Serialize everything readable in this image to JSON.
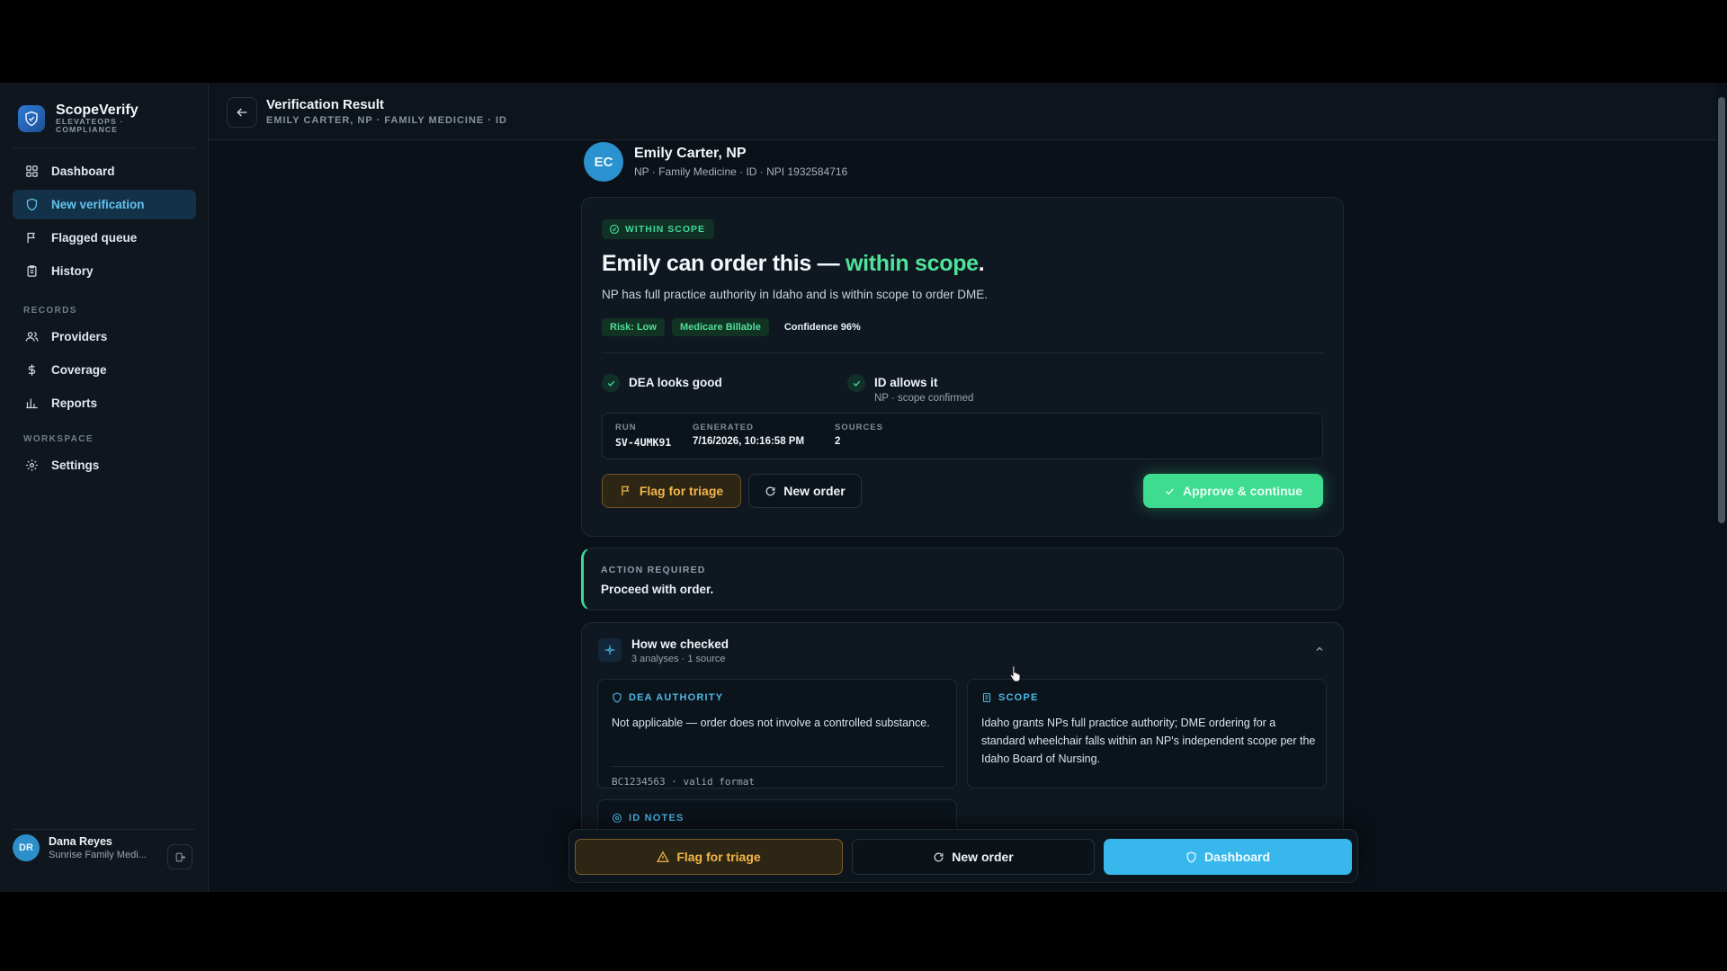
{
  "brand": {
    "name": "ScopeVerify",
    "subtitle": "ELEVATEOPS · COMPLIANCE"
  },
  "nav": {
    "main": [
      {
        "label": "Dashboard",
        "icon": "grid-icon",
        "active": false
      },
      {
        "label": "New verification",
        "icon": "shield-icon",
        "active": true
      },
      {
        "label": "Flagged queue",
        "icon": "flag-icon",
        "active": false
      },
      {
        "label": "History",
        "icon": "clipboard-icon",
        "active": false
      }
    ],
    "records_label": "RECORDS",
    "records": [
      {
        "label": "Providers",
        "icon": "users-icon"
      },
      {
        "label": "Coverage",
        "icon": "dollar-icon"
      },
      {
        "label": "Reports",
        "icon": "bar-chart-icon"
      }
    ],
    "workspace_label": "WORKSPACE",
    "workspace": [
      {
        "label": "Settings",
        "icon": "gear-icon"
      }
    ]
  },
  "user": {
    "initials": "DR",
    "name": "Dana Reyes",
    "org": "Sunrise Family Medi..."
  },
  "header": {
    "title": "Verification Result",
    "subtitle": "EMILY CARTER, NP · FAMILY MEDICINE · ID"
  },
  "provider": {
    "initials": "EC",
    "name": "Emily Carter, NP",
    "meta": "NP · Family Medicine · ID · NPI 1932584716"
  },
  "result": {
    "badge": "WITHIN SCOPE",
    "headline_prefix": "Emily can order this — ",
    "headline_highlight": "within scope",
    "headline_suffix": ".",
    "summary": "NP has full practice authority in Idaho and is within scope to order DME.",
    "chips": [
      "Risk: Low",
      "Medicare Billable"
    ],
    "confidence": "Confidence 96%",
    "checks": [
      {
        "title": "DEA looks good",
        "sub": ""
      },
      {
        "title": "ID allows it",
        "sub": "NP · scope confirmed"
      }
    ],
    "meta": [
      {
        "key": "RUN",
        "value": "SV-4UMK91"
      },
      {
        "key": "GENERATED",
        "value": "7/16/2026, 10:16:58 PM"
      },
      {
        "key": "SOURCES",
        "value": "2"
      }
    ],
    "buttons": {
      "flag": "Flag for triage",
      "new_order": "New order",
      "approve": "Approve & continue"
    }
  },
  "action_required": {
    "label": "ACTION REQUIRED",
    "text": "Proceed with order."
  },
  "how": {
    "title": "How we checked",
    "sub": "3 analyses · 1 source",
    "dea": {
      "label": "DEA AUTHORITY",
      "body": "Not applicable — order does not involve a controlled substance.",
      "foot": "BC1234563 · valid format"
    },
    "scope": {
      "label": "SCOPE",
      "body": "Idaho grants NPs full practice authority; DME ordering for a standard wheelchair falls within an NP's independent scope per the Idaho Board of Nursing."
    },
    "id_notes": {
      "label": "ID NOTES"
    }
  },
  "bottom_bar": {
    "flag": "Flag for triage",
    "new_order": "New order",
    "dashboard": "Dashboard"
  },
  "colors": {
    "accent": "#38b7ec",
    "success": "#3ddc8f",
    "warning": "#f2b548",
    "background": "#0b1118"
  }
}
